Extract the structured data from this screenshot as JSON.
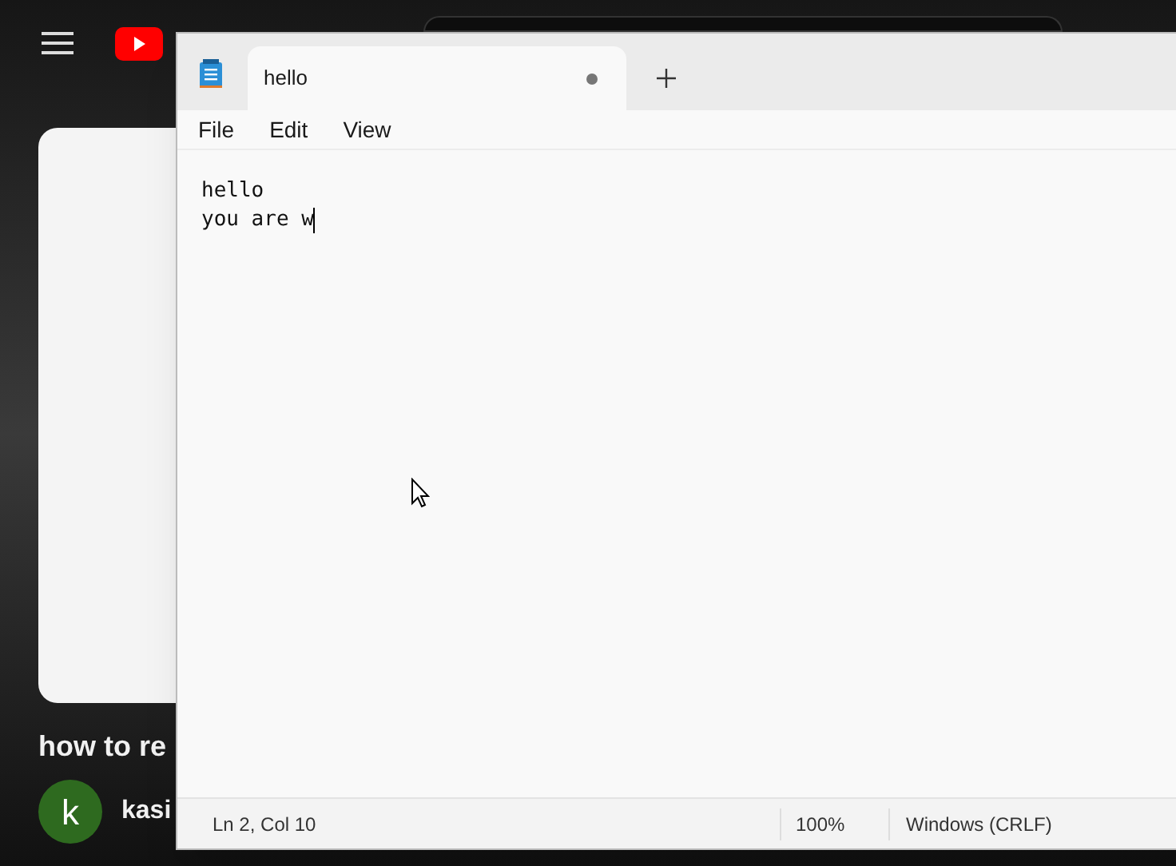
{
  "background_page": {
    "video_title": "how to re",
    "channel_avatar_letter": "k",
    "channel_name": "kasi"
  },
  "window": {
    "tabs": [
      {
        "label": "hello",
        "selected": true,
        "modified": true
      }
    ],
    "menu": [
      "File",
      "Edit",
      "View"
    ],
    "document_lines": [
      "hello",
      "you are w"
    ],
    "status_bar": {
      "position": "Ln 2, Col 10",
      "zoom": "100%",
      "line_ending": "Windows (CRLF)"
    }
  }
}
